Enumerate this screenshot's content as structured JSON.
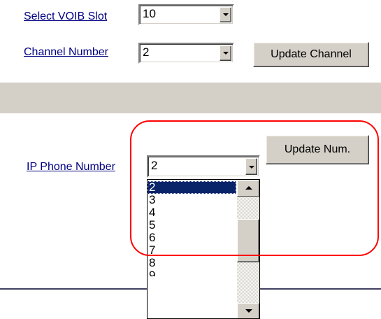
{
  "labels": {
    "voib_slot": "Select VOIB Slot",
    "channel_number": "Channel Number",
    "ip_phone_number": "IP Phone Number"
  },
  "selects": {
    "voib_slot_value": "10",
    "channel_value": "2",
    "ip_phone_value": "2"
  },
  "buttons": {
    "update_channel": "Update Channel",
    "update_num": "Update Num."
  },
  "dropdown_options": [
    "2",
    "3",
    "4",
    "5",
    "6",
    "7",
    "8"
  ],
  "dropdown_selected": "2",
  "colors": {
    "link": "#000080",
    "highlight": "#0a246a",
    "annotation": "#ff0000",
    "band": "#d4d0c8"
  }
}
